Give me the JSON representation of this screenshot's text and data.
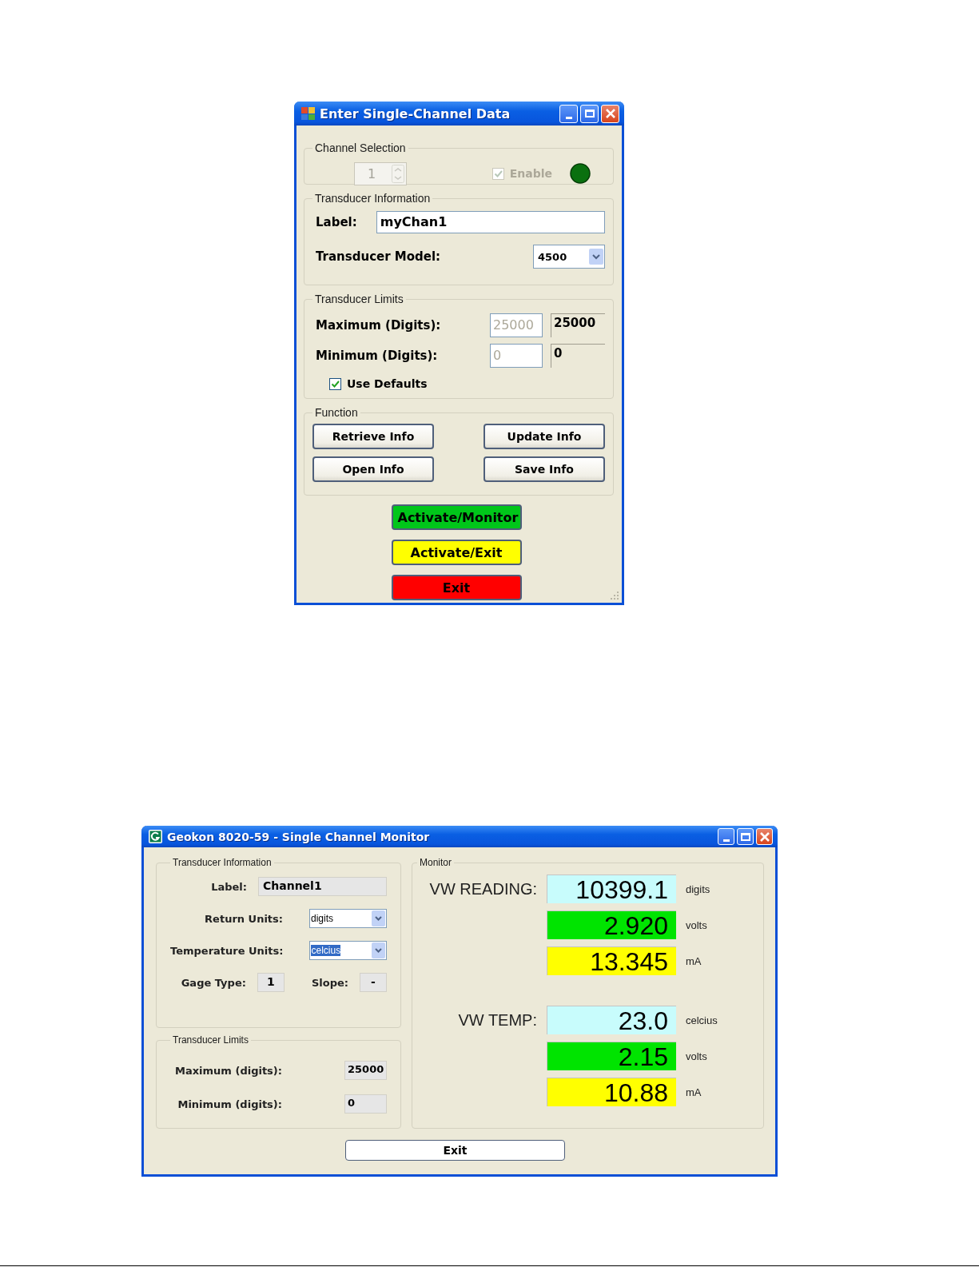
{
  "entry_window": {
    "title": "Enter Single-Channel Data",
    "channel_selection": {
      "title": "Channel Selection",
      "channel": "1",
      "disabled": true,
      "enable": {
        "label": "Enable",
        "checked": true,
        "disabled": true
      }
    },
    "transducer_information": {
      "title": "Transducer Information",
      "label": {
        "label": "Label:",
        "value": "myChan1"
      },
      "model": {
        "label": "Transducer Model:",
        "value": "4500"
      }
    },
    "transducer_limits": {
      "title": "Transducer Limits",
      "rows": [
        {
          "label": "Maximum (Digits):",
          "input": "25000",
          "current": "25000",
          "disabled": true
        },
        {
          "label": "Minimum (Digits):",
          "input": "0",
          "current": "0",
          "disabled": true
        }
      ],
      "use_defaults": {
        "label": "Use Defaults",
        "checked": true
      }
    },
    "function": {
      "title": "Function",
      "buttons": [
        "Retrieve Info",
        "Update Info",
        "Open Info",
        "Save Info"
      ]
    },
    "action_buttons": [
      {
        "label": "Activate/Monitor",
        "kind": "monitor"
      },
      {
        "label": "Activate/Exit",
        "kind": "activate"
      },
      {
        "label": "Exit",
        "kind": "exit"
      }
    ]
  },
  "monitor_window": {
    "title": "Geokon 8020-59 - Single Channel Monitor",
    "transducer_information": {
      "title": "Transducer Information",
      "label": {
        "label": "Label:",
        "value": "Channel1"
      },
      "return_units": {
        "label": "Return Units:",
        "value": "digits",
        "text_selected": false
      },
      "temperature_units": {
        "label": "Temperature Units:",
        "value": "celcius",
        "text_selected": true
      },
      "gage_type": {
        "label": "Gage Type:",
        "value": "1"
      },
      "slope": {
        "label": "Slope:",
        "value": "-"
      }
    },
    "transducer_limits": {
      "title": "Transducer Limits",
      "rows": [
        {
          "label": "Maximum (digits):",
          "value": "25000"
        },
        {
          "label": "Minimum (digits):",
          "value": "0"
        }
      ]
    },
    "monitor": {
      "title": "Monitor",
      "groups": [
        {
          "label": "VW READING:",
          "readings": [
            {
              "value": "10399.1",
              "unit": "digits",
              "kind": "primary"
            },
            {
              "value": "2.920",
              "unit": "volts",
              "kind": "volts"
            },
            {
              "value": "13.345",
              "unit": "mA",
              "kind": "current"
            }
          ]
        },
        {
          "label": "VW TEMP:",
          "readings": [
            {
              "value": "23.0",
              "unit": "celcius",
              "kind": "primary"
            },
            {
              "value": "2.15",
              "unit": "volts",
              "kind": "volts"
            },
            {
              "value": "10.88",
              "unit": "mA",
              "kind": "current"
            }
          ]
        }
      ]
    },
    "exit_button": "Exit"
  }
}
